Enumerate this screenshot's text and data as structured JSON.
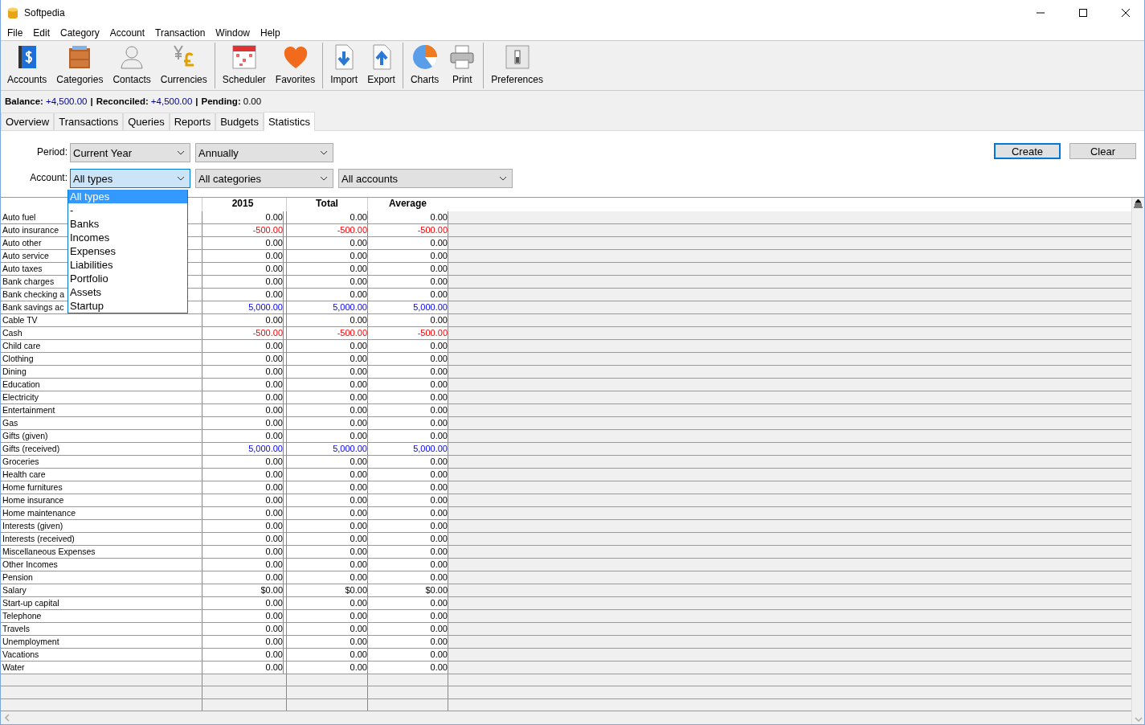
{
  "window": {
    "title": "Softpedia"
  },
  "menu": [
    "File",
    "Edit",
    "Category",
    "Account",
    "Transaction",
    "Window",
    "Help"
  ],
  "toolbar": [
    [
      {
        "label": "Accounts",
        "kind": "accounts"
      },
      {
        "label": "Categories",
        "kind": "categories"
      },
      {
        "label": "Contacts",
        "kind": "contacts"
      },
      {
        "label": "Currencies",
        "kind": "currencies"
      }
    ],
    [
      {
        "label": "Scheduler",
        "kind": "scheduler"
      },
      {
        "label": "Favorites",
        "kind": "favorites"
      }
    ],
    [
      {
        "label": "Import",
        "kind": "import"
      },
      {
        "label": "Export",
        "kind": "export"
      }
    ],
    [
      {
        "label": "Charts",
        "kind": "charts"
      },
      {
        "label": "Print",
        "kind": "print"
      }
    ],
    [
      {
        "label": "Preferences",
        "kind": "preferences"
      }
    ]
  ],
  "status": [
    {
      "label": "Balance:",
      "value": "+4,500.00",
      "kind": "signed"
    },
    {
      "separator": "|",
      "label": "Reconciled:",
      "value": "+4,500.00",
      "kind": "signed"
    },
    {
      "separator": "|",
      "label": "Pending:",
      "value": "0.00",
      "kind": "plain"
    }
  ],
  "tabs": [
    {
      "label": "Overview",
      "selected": false
    },
    {
      "label": "Transactions",
      "selected": false
    },
    {
      "label": "Queries",
      "selected": false
    },
    {
      "label": "Reports",
      "selected": false
    },
    {
      "label": "Budgets",
      "selected": false
    },
    {
      "label": "Statistics",
      "selected": true
    }
  ],
  "filters": {
    "period_label": "Period:",
    "period": "Current Year",
    "interval": "Annually",
    "account_label": "Account:",
    "account_type": "All types",
    "category": "All categories",
    "accounts": "All accounts"
  },
  "buttons": [
    {
      "label": "Create",
      "selected": true
    },
    {
      "label": "Clear",
      "selected": false
    }
  ],
  "dropdown": [
    {
      "label": "All types",
      "selected": true
    },
    {
      "label": "-",
      "selected": false
    },
    {
      "label": "Banks",
      "selected": false
    },
    {
      "label": "Incomes",
      "selected": false
    },
    {
      "label": "Expenses",
      "selected": false
    },
    {
      "label": "Liabilities",
      "selected": false
    },
    {
      "label": "Portfolio",
      "selected": false
    },
    {
      "label": "Assets",
      "selected": false
    },
    {
      "label": "Startup",
      "selected": false
    }
  ],
  "table": {
    "columns": [
      "2015",
      "Total",
      "Average"
    ],
    "rows": [
      {
        "name": "Auto fuel",
        "values": [
          "0.00",
          "0.00",
          "0.00"
        ],
        "kind": "neutral"
      },
      {
        "name": "Auto insurance",
        "values": [
          "-500.00",
          "-500.00",
          "-500.00"
        ],
        "kind": "negative"
      },
      {
        "name": "Auto other",
        "values": [
          "0.00",
          "0.00",
          "0.00"
        ],
        "kind": "neutral"
      },
      {
        "name": "Auto service",
        "values": [
          "0.00",
          "0.00",
          "0.00"
        ],
        "kind": "neutral"
      },
      {
        "name": "Auto taxes",
        "values": [
          "0.00",
          "0.00",
          "0.00"
        ],
        "kind": "neutral"
      },
      {
        "name": "Bank charges",
        "values": [
          "0.00",
          "0.00",
          "0.00"
        ],
        "kind": "neutral"
      },
      {
        "name": "Bank checking a",
        "values": [
          "0.00",
          "0.00",
          "0.00"
        ],
        "kind": "neutral"
      },
      {
        "name": "Bank savings ac",
        "values": [
          "5,000.00",
          "5,000.00",
          "5,000.00"
        ],
        "kind": "positive"
      },
      {
        "name": "Cable TV",
        "values": [
          "0.00",
          "0.00",
          "0.00"
        ],
        "kind": "neutral"
      },
      {
        "name": "Cash",
        "values": [
          "-500.00",
          "-500.00",
          "-500.00"
        ],
        "kind": "negative"
      },
      {
        "name": "Child care",
        "values": [
          "0.00",
          "0.00",
          "0.00"
        ],
        "kind": "neutral"
      },
      {
        "name": "Clothing",
        "values": [
          "0.00",
          "0.00",
          "0.00"
        ],
        "kind": "neutral"
      },
      {
        "name": "Dining",
        "values": [
          "0.00",
          "0.00",
          "0.00"
        ],
        "kind": "neutral"
      },
      {
        "name": "Education",
        "values": [
          "0.00",
          "0.00",
          "0.00"
        ],
        "kind": "neutral"
      },
      {
        "name": "Electricity",
        "values": [
          "0.00",
          "0.00",
          "0.00"
        ],
        "kind": "neutral"
      },
      {
        "name": "Entertainment",
        "values": [
          "0.00",
          "0.00",
          "0.00"
        ],
        "kind": "neutral"
      },
      {
        "name": "Gas",
        "values": [
          "0.00",
          "0.00",
          "0.00"
        ],
        "kind": "neutral"
      },
      {
        "name": "Gifts (given)",
        "values": [
          "0.00",
          "0.00",
          "0.00"
        ],
        "kind": "neutral"
      },
      {
        "name": "Gifts (received)",
        "values": [
          "5,000.00",
          "5,000.00",
          "5,000.00"
        ],
        "kind": "positive"
      },
      {
        "name": "Groceries",
        "values": [
          "0.00",
          "0.00",
          "0.00"
        ],
        "kind": "neutral"
      },
      {
        "name": "Health care",
        "values": [
          "0.00",
          "0.00",
          "0.00"
        ],
        "kind": "neutral"
      },
      {
        "name": "Home furnitures",
        "values": [
          "0.00",
          "0.00",
          "0.00"
        ],
        "kind": "neutral"
      },
      {
        "name": "Home insurance",
        "values": [
          "0.00",
          "0.00",
          "0.00"
        ],
        "kind": "neutral"
      },
      {
        "name": "Home maintenance",
        "values": [
          "0.00",
          "0.00",
          "0.00"
        ],
        "kind": "neutral"
      },
      {
        "name": "Interests (given)",
        "values": [
          "0.00",
          "0.00",
          "0.00"
        ],
        "kind": "neutral"
      },
      {
        "name": "Interests (received)",
        "values": [
          "0.00",
          "0.00",
          "0.00"
        ],
        "kind": "neutral"
      },
      {
        "name": "Miscellaneous Expenses",
        "values": [
          "0.00",
          "0.00",
          "0.00"
        ],
        "kind": "neutral"
      },
      {
        "name": "Other Incomes",
        "values": [
          "0.00",
          "0.00",
          "0.00"
        ],
        "kind": "neutral"
      },
      {
        "name": "Pension",
        "values": [
          "0.00",
          "0.00",
          "0.00"
        ],
        "kind": "neutral"
      },
      {
        "name": "Salary",
        "values": [
          "$0.00",
          "$0.00",
          "$0.00"
        ],
        "kind": "neutral"
      },
      {
        "name": "Start-up capital",
        "values": [
          "0.00",
          "0.00",
          "0.00"
        ],
        "kind": "neutral"
      },
      {
        "name": "Telephone",
        "values": [
          "0.00",
          "0.00",
          "0.00"
        ],
        "kind": "neutral"
      },
      {
        "name": "Travels",
        "values": [
          "0.00",
          "0.00",
          "0.00"
        ],
        "kind": "neutral"
      },
      {
        "name": "Unemployment",
        "values": [
          "0.00",
          "0.00",
          "0.00"
        ],
        "kind": "neutral"
      },
      {
        "name": "Vacations",
        "values": [
          "0.00",
          "0.00",
          "0.00"
        ],
        "kind": "neutral"
      },
      {
        "name": "Water",
        "values": [
          "0.00",
          "0.00",
          "0.00"
        ],
        "kind": "neutral"
      }
    ]
  }
}
